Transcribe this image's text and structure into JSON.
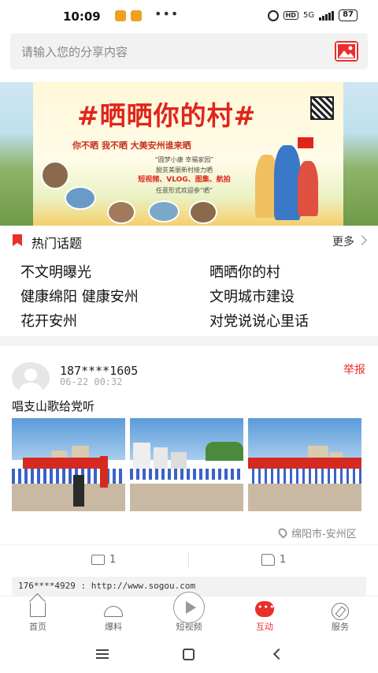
{
  "status_bar": {
    "time": "10:09",
    "network": "5G",
    "hd": "HD",
    "battery": "87"
  },
  "search": {
    "placeholder": "请输入您的分享内容"
  },
  "banner": {
    "title": "#晒晒你的村#",
    "slogan": "你不晒  我不晒  大美安州谁来晒",
    "desc_line1": "“圆梦小康 幸福家园”",
    "desc_line2": "脱贫美丽新村接力晒",
    "desc_line3": "短视频、VLOG、图集、航拍",
    "desc_line4": "任意形式欢迎参“晒”"
  },
  "hot_topics": {
    "title": "热门话题",
    "more": "更多",
    "items": [
      "不文明曝光",
      "晒晒你的村",
      "健康绵阳  健康安州",
      "文明城市建设",
      "花开安州",
      "对党说说心里话"
    ]
  },
  "post": {
    "username": "187****1605",
    "time": "06-22 00:32",
    "report": "举报",
    "text": "唱支山歌给党听",
    "location": "绵阳市-安州区",
    "comments": "1",
    "likes": "1",
    "comment_preview": "176****4929 : http://www.sogou.com"
  },
  "tabbar": {
    "items": [
      {
        "label": "首页",
        "icon": "home-icon"
      },
      {
        "label": "爆料",
        "icon": "broadcast-icon"
      },
      {
        "label": "短视频",
        "icon": "video-play-icon"
      },
      {
        "label": "互动",
        "icon": "chat-icon",
        "active": true
      },
      {
        "label": "服务",
        "icon": "compass-icon"
      }
    ],
    "active_color": "#e8302a"
  },
  "colors": {
    "accent": "#e8302a"
  }
}
